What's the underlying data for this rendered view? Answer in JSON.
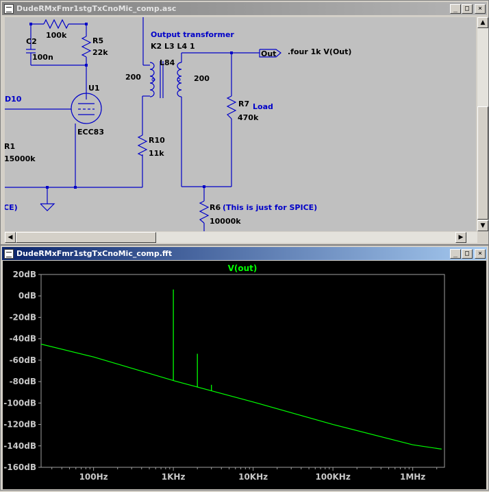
{
  "schematic_window": {
    "title": "DudeRMxFmr1stgTxCnoMic_comp.asc",
    "buttons": {
      "minimize": "_",
      "maximize": "□",
      "close": "×"
    },
    "labels": {
      "c2": "C2",
      "c2_val": "100n",
      "r_fb_val": "100k",
      "r5": "R5",
      "r5_val": "22k",
      "u1": "U1",
      "u1_val": "ECC83",
      "net_left": "D10",
      "r1": "R1",
      "r1_val": "15000k",
      "spice_left": "CE)",
      "xfmr_title": "Output transformer",
      "coupling": "K2 L3 L4 1",
      "l84": "L84",
      "n_left": "200",
      "n_right": "200",
      "out_flag": "Out",
      "four_directive": ".four 1k V(Out)",
      "r7": "R7",
      "r7_val": "470k",
      "load": "Load",
      "r10": "R10",
      "r10_val": "11k",
      "r6": "R6",
      "r6_note": "(This is just for SPICE)",
      "r6_val": "10000k"
    }
  },
  "fft_window": {
    "title": "DudeRMxFmr1stgTxCnoMic_comp.fft",
    "buttons": {
      "minimize": "_",
      "maximize": "□",
      "close": "×"
    },
    "accent": "#0a246a"
  },
  "chart_data": {
    "type": "line",
    "title": "V(out)",
    "xlabel": "",
    "ylabel": "",
    "x_scale": "log",
    "y_ticks": [
      "20dB",
      "0dB",
      "-20dB",
      "-40dB",
      "-60dB",
      "-80dB",
      "-100dB",
      "-120dB",
      "-140dB",
      "-160dB"
    ],
    "x_ticks": [
      "100Hz",
      "1KHz",
      "10KHz",
      "100KHz",
      "1MHz"
    ],
    "ylim": [
      -160,
      20
    ],
    "xlim_hz": [
      22,
      2500000
    ],
    "series": [
      {
        "color": "#00ff00",
        "noise_floor": [
          [
            22,
            -45
          ],
          [
            100,
            -57
          ],
          [
            1000,
            -79
          ],
          [
            10000,
            -99
          ],
          [
            100000,
            -120
          ],
          [
            1000000,
            -139
          ],
          [
            2300000,
            -143
          ]
        ],
        "peaks": [
          [
            1000,
            6
          ],
          [
            2000,
            -54
          ],
          [
            3000,
            -83
          ]
        ]
      }
    ]
  }
}
